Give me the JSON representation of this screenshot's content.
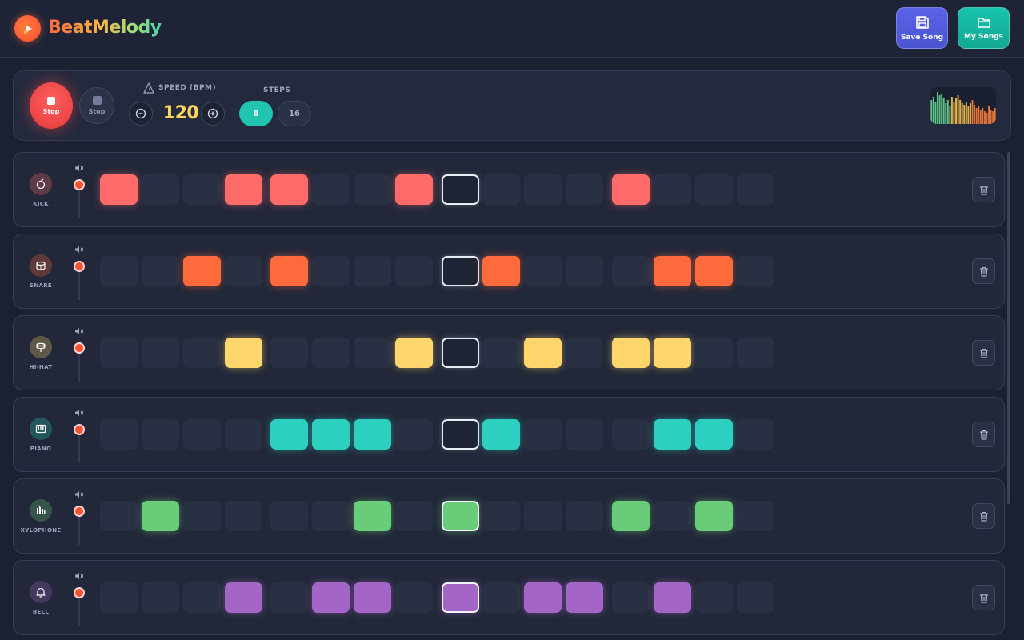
{
  "app": {
    "name": "BeatMelody"
  },
  "header": {
    "save_label": "Save Song",
    "songs_label": "My Songs"
  },
  "controls": {
    "play_label": "Stop",
    "stop_label": "Stop",
    "speed_label": "SPEED (BPM)",
    "bpm": "120",
    "steps_label": "STEPS",
    "step_options": [
      "8",
      "16"
    ],
    "selected_steps": "8"
  },
  "playhead_step": 8,
  "tracks": [
    {
      "name": "KICK",
      "color": "#ff6b6b",
      "icon": "kick-drum-icon",
      "pattern": [
        1,
        0,
        0,
        1,
        1,
        0,
        0,
        1,
        0,
        0,
        0,
        0,
        1,
        0,
        0,
        0
      ]
    },
    {
      "name": "SNARE",
      "color": "#ff6a3d",
      "icon": "snare-drum-icon",
      "pattern": [
        0,
        0,
        1,
        0,
        1,
        0,
        0,
        0,
        0,
        1,
        0,
        0,
        0,
        1,
        1,
        0
      ]
    },
    {
      "name": "HI-HAT",
      "color": "#ffd66b",
      "icon": "hi-hat-icon",
      "pattern": [
        0,
        0,
        0,
        1,
        0,
        0,
        0,
        1,
        0,
        0,
        1,
        0,
        1,
        1,
        0,
        0
      ]
    },
    {
      "name": "PIANO",
      "color": "#2ccfc0",
      "icon": "piano-icon",
      "pattern": [
        0,
        0,
        0,
        0,
        1,
        1,
        1,
        0,
        0,
        1,
        0,
        0,
        0,
        1,
        1,
        0
      ]
    },
    {
      "name": "XYLOPHONE",
      "color": "#69cc79",
      "icon": "xylophone-icon",
      "pattern": [
        0,
        1,
        0,
        0,
        0,
        0,
        1,
        0,
        1,
        0,
        0,
        0,
        1,
        0,
        1,
        0
      ]
    },
    {
      "name": "BELL",
      "color": "#a366c7",
      "icon": "bell-icon",
      "pattern": [
        0,
        0,
        0,
        1,
        0,
        1,
        1,
        0,
        1,
        0,
        1,
        1,
        0,
        1,
        0,
        0
      ]
    }
  ]
}
